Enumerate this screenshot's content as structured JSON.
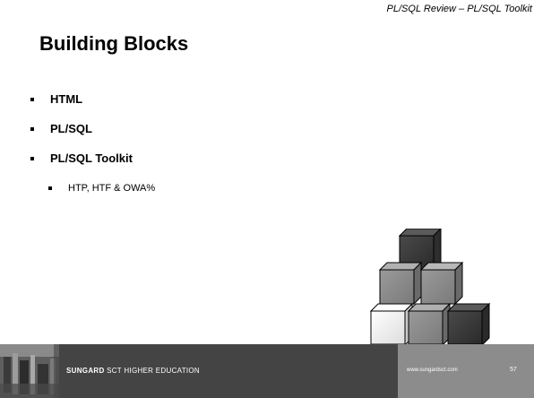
{
  "header": {
    "course_title": "PL/SQL  Review – PL/SQL Toolkit"
  },
  "slide": {
    "title": "Building Blocks",
    "bullets": [
      {
        "label": "HTML"
      },
      {
        "label": "PL/SQL"
      },
      {
        "label": "PL/SQL Toolkit"
      }
    ],
    "sub_bullets": [
      {
        "label": "HTP, HTF & OWA%"
      }
    ]
  },
  "footer": {
    "brand_bold": "SUNGARD",
    "brand_rest": " SCT HIGHER EDUCATION",
    "url": "www.sungardsct.com",
    "page_number": "57"
  },
  "colors": {
    "footer_dark": "#444444",
    "footer_light": "#8c8c8c",
    "block_dark": "#3c3c3c",
    "block_mid": "#8a8a8a",
    "block_light": "#f0f0f0"
  },
  "icons": {
    "illustration": "stacked-blocks-icon",
    "footer_image": "classroom-photo"
  }
}
